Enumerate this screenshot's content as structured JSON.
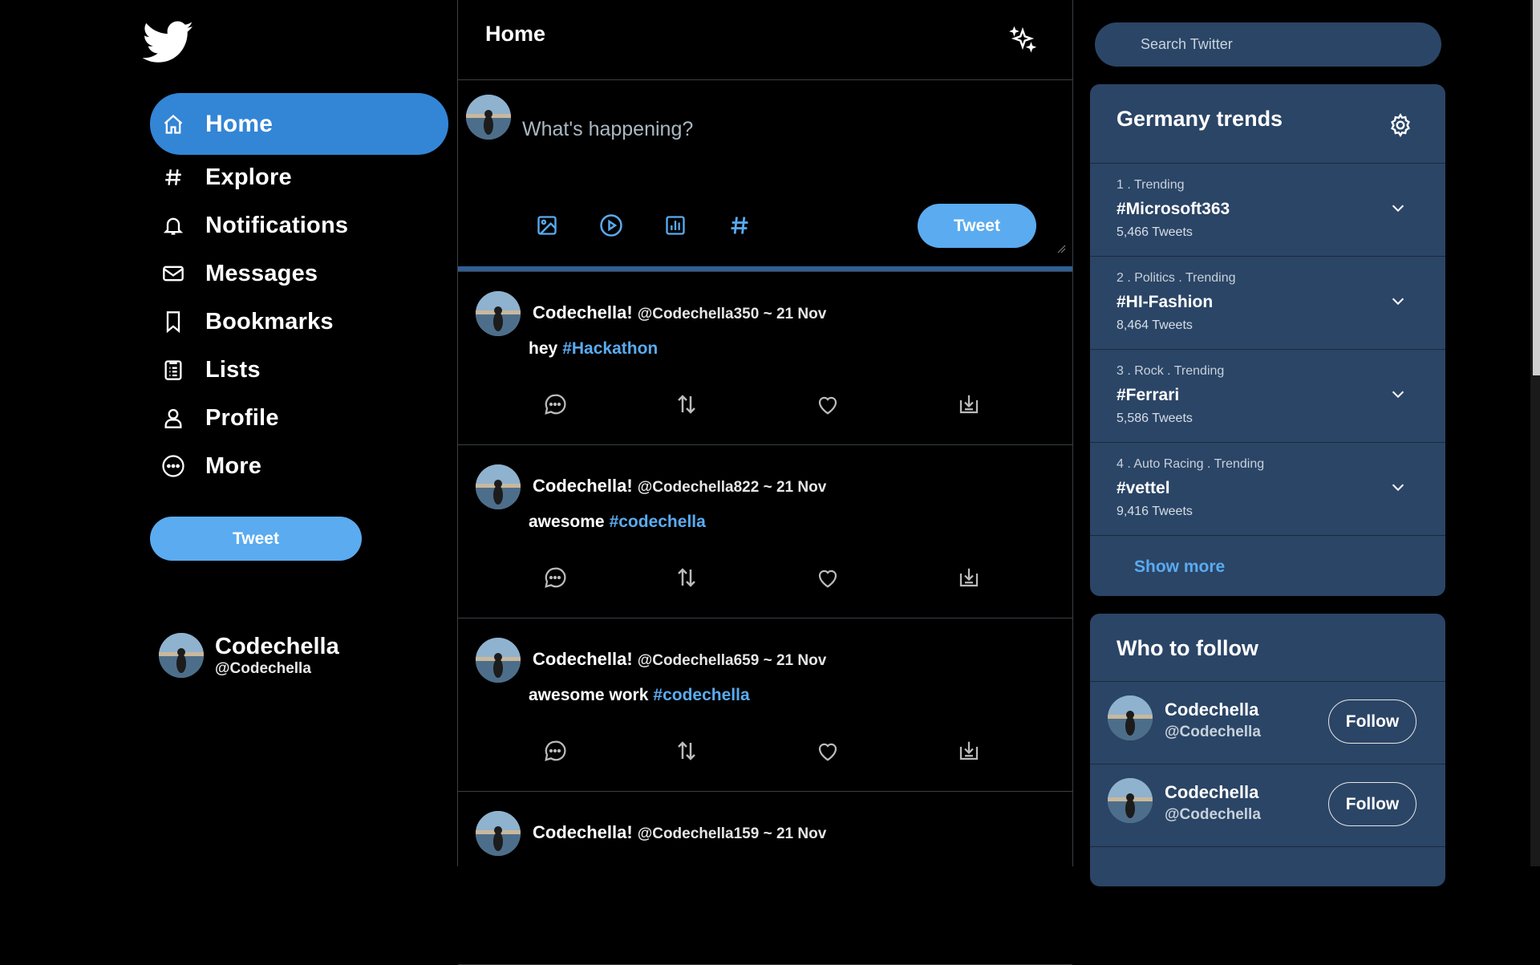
{
  "brand": {
    "logo_icon": "twitter-bird-icon",
    "accent": "#5aabf0",
    "nav_active": "#3385d6",
    "panel_bg": "#2b4566"
  },
  "nav": {
    "items": [
      {
        "label": "Home",
        "icon": "home-icon",
        "active": true
      },
      {
        "label": "Explore",
        "icon": "hashtag-icon"
      },
      {
        "label": "Notifications",
        "icon": "bell-icon"
      },
      {
        "label": "Messages",
        "icon": "mail-icon"
      },
      {
        "label": "Bookmarks",
        "icon": "bookmark-icon"
      },
      {
        "label": "Lists",
        "icon": "list-icon"
      },
      {
        "label": "Profile",
        "icon": "user-icon"
      },
      {
        "label": "More",
        "icon": "more-circle-icon"
      }
    ],
    "tweet_button": "Tweet"
  },
  "account": {
    "name": "Codechella",
    "handle": "@Codechella"
  },
  "main": {
    "title": "Home",
    "compose": {
      "placeholder": "What's happening?",
      "tweet_button": "Tweet"
    },
    "tweets": [
      {
        "name": "Codechella!",
        "meta": "@Codechella350 ~ 21 Nov",
        "text": "hey",
        "tag": "#Hackathon"
      },
      {
        "name": "Codechella!",
        "meta": "@Codechella822 ~ 21 Nov",
        "text": "awesome",
        "tag": "#codechella"
      },
      {
        "name": "Codechella!",
        "meta": "@Codechella659 ~ 21 Nov",
        "text": "awesome work",
        "tag": "#codechella"
      },
      {
        "name": "Codechella!",
        "meta": "@Codechella159 ~ 21 Nov",
        "text": "",
        "tag": ""
      }
    ]
  },
  "search": {
    "placeholder": "Search Twitter"
  },
  "trends": {
    "title": "Germany trends",
    "items": [
      {
        "context": "1 . Trending",
        "tag": "#Microsoft363",
        "count": "5,466 Tweets"
      },
      {
        "context": "2 . Politics . Trending",
        "tag": "#HI-Fashion",
        "count": "8,464 Tweets"
      },
      {
        "context": "3 . Rock . Trending",
        "tag": "#Ferrari",
        "count": "5,586 Tweets"
      },
      {
        "context": "4 . Auto Racing . Trending",
        "tag": "#vettel",
        "count": "9,416 Tweets"
      }
    ],
    "show_more": "Show more"
  },
  "who_to_follow": {
    "title": "Who to follow",
    "items": [
      {
        "name": "Codechella",
        "handle": "@Codechella",
        "button": "Follow"
      },
      {
        "name": "Codechella",
        "handle": "@Codechella",
        "button": "Follow"
      }
    ]
  }
}
